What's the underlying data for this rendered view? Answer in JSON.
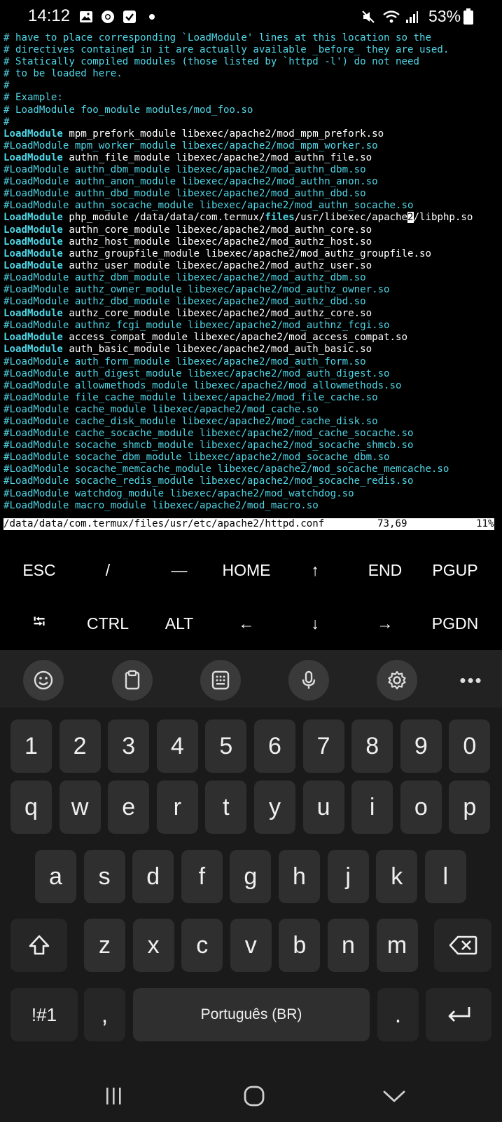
{
  "status_bar": {
    "time": "14:12",
    "battery": "53%",
    "left_icons": [
      "image-icon",
      "chrome-icon",
      "check-task-icon",
      "dot-icon"
    ],
    "right_icons": [
      "mute-icon",
      "wifi-icon",
      "signal-icon",
      "battery-icon"
    ]
  },
  "terminal": {
    "colors": {
      "comment": "#4fd6e6",
      "plain": "#ffffff"
    },
    "lines": [
      {
        "t": "comment",
        "text": "# have to place corresponding `LoadModule' lines at this location so the"
      },
      {
        "t": "comment",
        "text": "# directives contained in it are actually available _before_ they are used."
      },
      {
        "t": "comment",
        "text": "# Statically compiled modules (those listed by `httpd -l') do not need"
      },
      {
        "t": "comment",
        "text": "# to be loaded here."
      },
      {
        "t": "comment",
        "text": "#"
      },
      {
        "t": "comment",
        "text": "# Example:"
      },
      {
        "t": "comment",
        "text": "# LoadModule foo_module modules/mod_foo.so"
      },
      {
        "t": "comment",
        "text": "#"
      },
      {
        "t": "active",
        "kw": "LoadModule",
        "rest": " mpm_prefork_module libexec/apache2/mod_mpm_prefork.so"
      },
      {
        "t": "comment",
        "text": "#LoadModule mpm_worker_module libexec/apache2/mod_mpm_worker.so"
      },
      {
        "t": "active",
        "kw": "LoadModule",
        "rest": " authn_file_module libexec/apache2/mod_authn_file.so"
      },
      {
        "t": "comment",
        "text": "#LoadModule authn_dbm_module libexec/apache2/mod_authn_dbm.so"
      },
      {
        "t": "comment",
        "text": "#LoadModule authn_anon_module libexec/apache2/mod_authn_anon.so"
      },
      {
        "t": "comment",
        "text": "#LoadModule authn_dbd_module libexec/apache2/mod_authn_dbd.so"
      },
      {
        "t": "comment",
        "text": "#LoadModule authn_socache_module libexec/apache2/mod_authn_socache.so"
      },
      {
        "t": "php"
      },
      {
        "t": "active",
        "kw": "LoadModule",
        "rest": " authn_core_module libexec/apache2/mod_authn_core.so"
      },
      {
        "t": "active",
        "kw": "LoadModule",
        "rest": " authz_host_module libexec/apache2/mod_authz_host.so"
      },
      {
        "t": "active",
        "kw": "LoadModule",
        "rest": " authz_groupfile_module libexec/apache2/mod_authz_groupfile.so"
      },
      {
        "t": "active",
        "kw": "LoadModule",
        "rest": " authz_user_module libexec/apache2/mod_authz_user.so"
      },
      {
        "t": "comment",
        "text": "#LoadModule authz_dbm_module libexec/apache2/mod_authz_dbm.so"
      },
      {
        "t": "comment",
        "text": "#LoadModule authz_owner_module libexec/apache2/mod_authz_owner.so"
      },
      {
        "t": "comment",
        "text": "#LoadModule authz_dbd_module libexec/apache2/mod_authz_dbd.so"
      },
      {
        "t": "active",
        "kw": "LoadModule",
        "rest": " authz_core_module libexec/apache2/mod_authz_core.so"
      },
      {
        "t": "comment",
        "text": "#LoadModule authnz_fcgi_module libexec/apache2/mod_authnz_fcgi.so"
      },
      {
        "t": "active",
        "kw": "LoadModule",
        "rest": " access_compat_module libexec/apache2/mod_access_compat.so"
      },
      {
        "t": "active",
        "kw": "LoadModule",
        "rest": " auth_basic_module libexec/apache2/mod_auth_basic.so"
      },
      {
        "t": "comment",
        "text": "#LoadModule auth_form_module libexec/apache2/mod_auth_form.so"
      },
      {
        "t": "comment",
        "text": "#LoadModule auth_digest_module libexec/apache2/mod_auth_digest.so"
      },
      {
        "t": "comment",
        "text": "#LoadModule allowmethods_module libexec/apache2/mod_allowmethods.so"
      },
      {
        "t": "comment",
        "text": "#LoadModule file_cache_module libexec/apache2/mod_file_cache.so"
      },
      {
        "t": "comment",
        "text": "#LoadModule cache_module libexec/apache2/mod_cache.so"
      },
      {
        "t": "comment",
        "text": "#LoadModule cache_disk_module libexec/apache2/mod_cache_disk.so"
      },
      {
        "t": "comment",
        "text": "#LoadModule cache_socache_module libexec/apache2/mod_cache_socache.so"
      },
      {
        "t": "comment",
        "text": "#LoadModule socache_shmcb_module libexec/apache2/mod_socache_shmcb.so"
      },
      {
        "t": "comment",
        "text": "#LoadModule socache_dbm_module libexec/apache2/mod_socache_dbm.so"
      },
      {
        "t": "comment",
        "text": "#LoadModule socache_memcache_module libexec/apache2/mod_socache_memcache.so"
      },
      {
        "t": "comment",
        "text": "#LoadModule socache_redis_module libexec/apache2/mod_socache_redis.so"
      },
      {
        "t": "comment",
        "text": "#LoadModule watchdog_module libexec/apache2/mod_watchdog.so"
      },
      {
        "t": "comment",
        "text": "#LoadModule macro_module libexec/apache2/mod_macro.so"
      }
    ],
    "php_line": {
      "kw": "LoadModule",
      "a": " php_module /data/data/com.termux/",
      "hl": "files",
      "b": "/usr/libexec/apache",
      "cursor": "2",
      "c": "/libphp.so"
    }
  },
  "vim_status": {
    "file": "/data/data/com.termux/files/usr/etc/apache2/httpd.conf",
    "position": "73,69",
    "percent": "11%"
  },
  "extra_keys": {
    "row1": [
      "ESC",
      "/",
      "—",
      "HOME",
      "↑",
      "END",
      "PGUP"
    ],
    "row2": [
      "⭾",
      "CTRL",
      "ALT",
      "←",
      "↓",
      "→",
      "PGDN"
    ]
  },
  "keyboard_toolbar": {
    "buttons": [
      "emoji-icon",
      "clipboard-icon",
      "keypad-icon",
      "microphone-icon",
      "settings-icon"
    ],
    "more": "•••"
  },
  "keyboard": {
    "numbers": [
      "1",
      "2",
      "3",
      "4",
      "5",
      "6",
      "7",
      "8",
      "9",
      "0"
    ],
    "row_q": [
      "q",
      "w",
      "e",
      "r",
      "t",
      "y",
      "u",
      "i",
      "o",
      "p"
    ],
    "row_a": [
      "a",
      "s",
      "d",
      "f",
      "g",
      "h",
      "j",
      "k",
      "l"
    ],
    "row_z": [
      "z",
      "x",
      "c",
      "v",
      "b",
      "n",
      "m"
    ],
    "symbols_label": "!#1",
    "comma": ",",
    "space_label": "Português (BR)",
    "period": "."
  },
  "nav_bar": {
    "buttons": [
      "recent-apps-icon",
      "home-icon",
      "back-icon"
    ]
  }
}
